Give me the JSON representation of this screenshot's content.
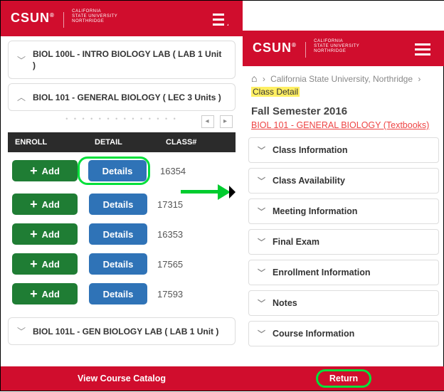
{
  "brand": {
    "logo": "CSUN",
    "subline1": "CALIFORNIA",
    "subline2": "STATE UNIVERSITY",
    "subline3": "NORTHRIDGE"
  },
  "left": {
    "accordions": [
      {
        "title": "BIOL 100L - INTRO BIOLOGY LAB ( LAB 1 Unit )",
        "expanded": false
      },
      {
        "title": "BIOL 101 - GENERAL BIOLOGY ( LEC 3 Units )",
        "expanded": true
      },
      {
        "title": "BIOL 101L - GEN BIOLOGY LAB ( LAB 1 Unit )",
        "expanded": false
      }
    ],
    "table": {
      "headers": {
        "enroll": "ENROLL",
        "detail": "DETAIL",
        "classnum": "CLASS#"
      },
      "add_label": "Add",
      "details_label": "Details",
      "rows": [
        {
          "classnum": "16354"
        },
        {
          "classnum": "17315"
        },
        {
          "classnum": "16353"
        },
        {
          "classnum": "17565"
        },
        {
          "classnum": "17593"
        }
      ]
    }
  },
  "right": {
    "breadcrumb": {
      "univ": "California State University, Northridge",
      "current": "Class Detail"
    },
    "semester": "Fall Semester 2016",
    "textbook_link": "BIOL 101 - GENERAL BIOLOGY (Textbooks)",
    "sections": [
      "Class Information",
      "Class Availability",
      "Meeting Information",
      "Final Exam",
      "Enrollment Information",
      "Notes",
      "Course Information"
    ]
  },
  "bottom": {
    "catalog": "View Course Catalog",
    "return": "Return"
  }
}
